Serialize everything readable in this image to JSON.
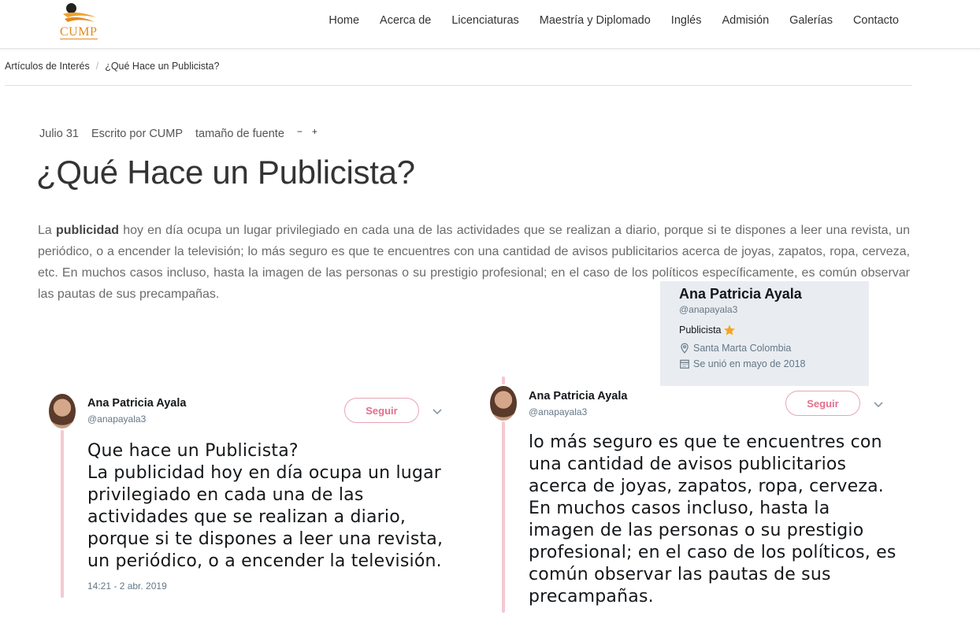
{
  "brand": {
    "logo_text": "CUMP",
    "accent": "#e38a1e"
  },
  "nav": {
    "items": [
      {
        "label": "Home"
      },
      {
        "label": "Acerca de"
      },
      {
        "label": "Licenciaturas"
      },
      {
        "label": "Maestría y Diplomado"
      },
      {
        "label": "Inglés"
      },
      {
        "label": "Admisión"
      },
      {
        "label": "Galerías"
      },
      {
        "label": "Contacto"
      }
    ]
  },
  "breadcrumb": {
    "parent": "Artículos de Interés",
    "separator": "/",
    "current": "¿Qué Hace un Publicista?"
  },
  "meta": {
    "date": "Julio 31",
    "author": "Escrito por  CUMP",
    "font_size_label": "tamaño de fuente",
    "decrease": "−",
    "increase": "+"
  },
  "article": {
    "title": "¿Qué Hace un Publicista?",
    "intro_pre": "La ",
    "intro_bold": "publicidad",
    "intro_post": " hoy en día ocupa un lugar privilegiado en cada una de las actividades que se realizan a diario, porque si te dispones a leer una revista, un periódico, o a encender la televisión; lo más seguro es que te encuentres con una cantidad de avisos publicitarios acerca de joyas, zapatos, ropa, cerveza, etc. En muchos casos incluso, hasta la imagen de las personas o su prestigio profesional; en el caso de los políticos específicamente, es común observar las pautas de sus precampañas."
  },
  "profile_card": {
    "name": "Ana Patricia Ayala",
    "handle": "@anapayala3",
    "bio": "Publicista",
    "location": "Santa Marta Colombia",
    "joined": "Se unió en mayo de 2018"
  },
  "tweets": [
    {
      "name": "Ana Patricia Ayala",
      "handle": "@anapayala3",
      "follow": "Seguir",
      "text_lines": [
        "Que hace un Publicista?",
        "La publicidad hoy en día ocupa un lugar",
        "privilegiado en cada una de las",
        "actividades que se realizan a diario,",
        "porque si te dispones a leer una revista,",
        "un periódico, o a encender la televisión."
      ],
      "time": "14:21 - 2 abr. 2019"
    },
    {
      "name": "Ana Patricia Ayala",
      "handle": "@anapayala3",
      "follow": "Seguir",
      "text_lines": [
        "lo más seguro es que te encuentres con",
        "una cantidad de avisos publicitarios",
        "acerca de joyas, zapatos, ropa, cerveza.",
        "En muchos casos incluso, hasta la",
        "imagen de las personas o su prestigio",
        "profesional; en el caso de los políticos, es",
        "común observar las pautas de sus",
        "precampañas."
      ]
    }
  ]
}
